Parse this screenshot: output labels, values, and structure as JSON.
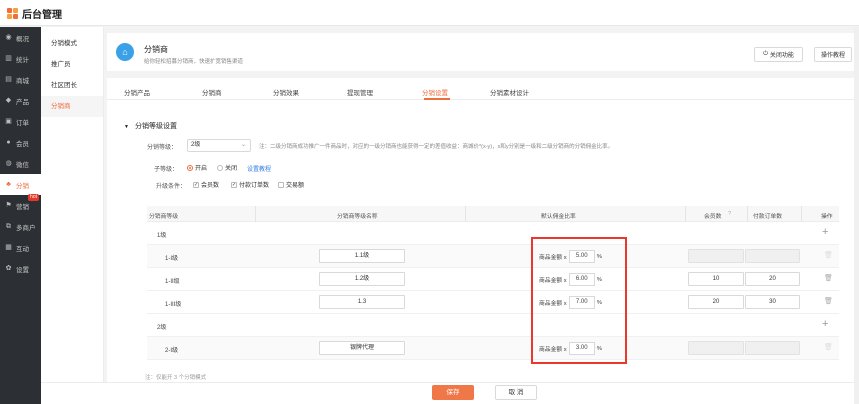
{
  "app": {
    "title": "后台管理"
  },
  "sidebar": {
    "items": [
      {
        "label": "概况",
        "icon": "dashboard-icon"
      },
      {
        "label": "统计",
        "icon": "chart-icon"
      },
      {
        "label": "商城",
        "icon": "store-icon"
      },
      {
        "label": "产品",
        "icon": "product-icon"
      },
      {
        "label": "订单",
        "icon": "order-icon"
      },
      {
        "label": "会员",
        "icon": "member-icon"
      },
      {
        "label": "微信",
        "icon": "wechat-icon"
      },
      {
        "label": "分销",
        "icon": "distribution-icon"
      },
      {
        "label": "营销",
        "icon": "flag-icon",
        "badge": "hot"
      },
      {
        "label": "多商户",
        "icon": "merchant-icon"
      },
      {
        "label": "互动",
        "icon": "interact-icon"
      },
      {
        "label": "设置",
        "icon": "gear-icon"
      }
    ]
  },
  "subnav": {
    "items": [
      "分销模式",
      "推广员",
      "社区团长",
      "分销商"
    ]
  },
  "header": {
    "title": "分销商",
    "subtitle": "给你轻松招募分销商，快速扩宽销售渠道",
    "close_label": "关闭功能",
    "tutorial_label": "操作教程"
  },
  "tabs": [
    "分销产品",
    "分销商",
    "分销效果",
    "提现管理",
    "分销设置",
    "分销素材设计"
  ],
  "section": {
    "title": "分销等级设置",
    "level_label": "分销等级：",
    "level_value": "2级",
    "note": "注：二级分销商成功推广一件商品时，对应的一级分销商也能获得一定的差值收益：商城价*(x-y)，x和y分别是一级和二级分销商的分销佣金比率。",
    "sublevel_label": "子等级：",
    "on_label": "开启",
    "off_label": "关闭",
    "tutorial_link": "设置教程",
    "upgrade_label": "升级条件：",
    "cond_members": "会员数",
    "cond_paid_orders": "付款订单数",
    "cond_trade": "交易额"
  },
  "table": {
    "headers": [
      "分销商等级",
      "分销商等级名称",
      "默认佣金比率",
      "会员数",
      "付款订单数",
      "操作"
    ],
    "rate_prefix": "商品金额 x",
    "rate_suffix": "%",
    "rows": [
      {
        "type": "group",
        "label": "1级"
      },
      {
        "type": "row",
        "label": "1-I级",
        "name": "1.1级",
        "rate": "5.00",
        "members": "",
        "orders": "",
        "disabled": true
      },
      {
        "type": "row",
        "label": "1-II级",
        "name": "1.2级",
        "rate": "6.00",
        "members": "10",
        "orders": "20",
        "disabled": false
      },
      {
        "type": "row",
        "label": "1-III级",
        "name": "1.3",
        "rate": "7.00",
        "members": "20",
        "orders": "30",
        "disabled": false
      },
      {
        "type": "group",
        "label": "2级"
      },
      {
        "type": "row",
        "label": "2-I级",
        "name": "银牌代理",
        "rate": "3.00",
        "members": "",
        "orders": "",
        "disabled": true
      }
    ]
  },
  "footer": {
    "note": "注：仅能开 3 个分销模式",
    "save_label": "保存",
    "cancel_label": "取 消"
  },
  "colors": {
    "accent": "#f06d3c",
    "highlight": "#e8392c",
    "sidebar": "#2c2f33"
  }
}
